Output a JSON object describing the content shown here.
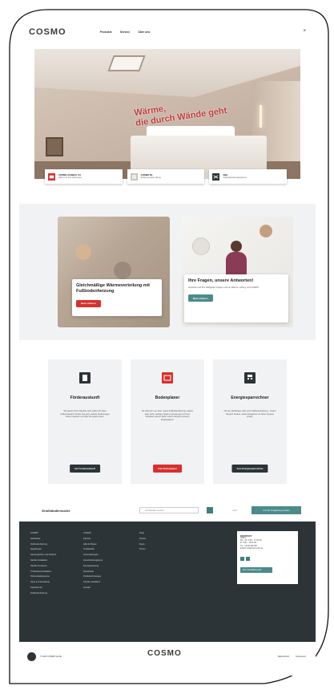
{
  "brand": {
    "logo": "COSMO",
    "logo_sub": ""
  },
  "header": {
    "nav": [
      "Produkte",
      "Service",
      "Über uns"
    ],
    "close_glyph": "×"
  },
  "hero": {
    "claim_line1": "Wärme,",
    "claim_line2": "die durch Wände geht",
    "cards": [
      {
        "title": "COSMO AUSBAU 3.0",
        "sub": "Wärme für Ihre Wohnungen",
        "icon": "radiator-icon"
      },
      {
        "title": "COSMO RL",
        "sub": "Einfach geniale Lüftung",
        "icon": "ventilation-icon"
      },
      {
        "title": "FBH",
        "sub": "Fußbodenheizungssysteme",
        "icon": "floorheating-icon"
      }
    ]
  },
  "promo": {
    "left": {
      "title": "Gleichmäßige Wärmeverteilung mit Fußbodenheizung",
      "button": "Mehr erfahren"
    },
    "right": {
      "title": "Ihre Fragen, unsere Antworten!",
      "text": "Antworten auf Ihre häufigsten Fragen rund um Wärme, Lüftung und COSMO.",
      "button": "Mehr erfahren"
    }
  },
  "tools": [
    {
      "title": "Förderauskunft",
      "text": "Wir planen Ihren Neubau oder wollen Ihr Haus modernisieren? Finden Sie jetzt, welche Förderungen Ihnen zustehen und was Sie sparen kann.",
      "button": "Zur Förderauskunft",
      "color": "#2c3438"
    },
    {
      "title": "Bodenplaner",
      "text": "Sie träumen von einer neuen Fußbodenheizung, wissen aber nicht, welches System und wie gut zu Ihrem Vorhaben passt? Dann nutzen Sie jetzt unseren Bodenplaner!",
      "button": "Zum Bodenplaner",
      "color": "#d6312e"
    },
    {
      "title": "Energiesparrechner",
      "text": "Ob neu Heizkörper oder eine Fußbodenheizung – finden Sie jetzt heraus, welche Ersparnis mit Ihrem System erzielt.",
      "button": "Zum Energiesparrechner",
      "color": "#2c3438"
    }
  ],
  "footer_search": {
    "label": "Großhändlersuche",
    "placeholder": "Großhändler suchen",
    "or": "oder",
    "near_button": "In Ihrer Umgebung suchen"
  },
  "footer": {
    "col1": [
      "KOSMO",
      "Heizkörper",
      "Fußbodenheizung",
      "Regelungen",
      "Heizungsrohre und Zubehör",
      "Sanitär installation",
      "Sanitär Armaturen",
      "Trinkwasserinstallation",
      "Photovoltaiksysteme",
      "Haus & Unterhaltung",
      "Solarthermie",
      "Fußbodenheizung"
    ],
    "col2": [
      "COSMO",
      "Karriere",
      "Hilfe & Wissen",
      "Großhandel",
      "Veranstaltungen",
      "Ausschreibungstexte",
      "Energieberatung",
      "Downloads",
      "Produktschulungen",
      "Sanitär installation",
      "Kontakt"
    ],
    "col3": [
      "Shop",
      "Presse",
      "News",
      "Promo"
    ],
    "contact": {
      "title": "KONTAKT",
      "lines": [
        "Hotline",
        "Mo – Do: 8:00 – 17:00 Uhr",
        "Fr: 8:00 – 15:00 Uhr",
        "Tel.: +49 40 000 000",
        "E-Mail: info@cosmo-info.de"
      ],
      "button": "Zum Kontaktformular"
    }
  },
  "bottom": {
    "copyright": "© 2023 COSMO GmbH",
    "links": [
      "Datenschutz",
      "Impressum"
    ]
  }
}
